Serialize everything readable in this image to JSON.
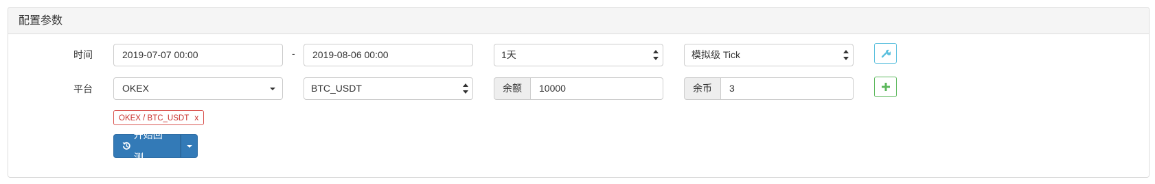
{
  "panel": {
    "title": "配置参数"
  },
  "time_row": {
    "label": "时间",
    "start": "2019-07-07 00:00",
    "separator": "-",
    "end": "2019-08-06 00:00",
    "period": "1天",
    "mode": "模拟级 Tick",
    "settings_icon": "wrench-icon"
  },
  "platform_row": {
    "label": "平台",
    "exchange": "OKEX",
    "pair": "BTC_USDT",
    "balance_label": "余额",
    "balance_value": "10000",
    "coins_label": "余币",
    "coins_value": "3",
    "add_icon": "plus-icon"
  },
  "tags": [
    {
      "text": "OKEX / BTC_USDT",
      "remove": "x"
    }
  ],
  "actions": {
    "start_label": "开始回测",
    "start_icon": "history-icon",
    "dropdown_icon": "caret-down-icon"
  },
  "colors": {
    "primary": "#337ab7",
    "info": "#5bc0de",
    "success": "#5cb85c",
    "danger": "#d9534f"
  }
}
